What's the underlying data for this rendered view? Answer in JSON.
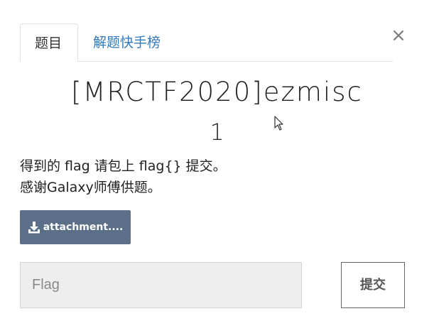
{
  "dialog": {
    "close_label": "×",
    "tabs": [
      {
        "label": "题目",
        "active": true
      },
      {
        "label": "解题快手榜",
        "active": false
      }
    ],
    "challenge": {
      "title": "[MRCTF2020]ezmisc",
      "value": "1",
      "description_lines": [
        "得到的 flag 请包上 flag{} 提交。",
        "感谢Galaxy师傅供题。"
      ],
      "attachment_label": "attachment...."
    },
    "flag_input": {
      "placeholder": "Flag",
      "value": ""
    },
    "submit_label": "提交"
  },
  "colors": {
    "tab_link": "#337ab7",
    "attachment_bg": "#5b7088",
    "input_bg": "#eeeeee"
  },
  "icons": {
    "close": "close-icon",
    "attachment": "download-icon",
    "pointer": "mouse-cursor-icon"
  }
}
